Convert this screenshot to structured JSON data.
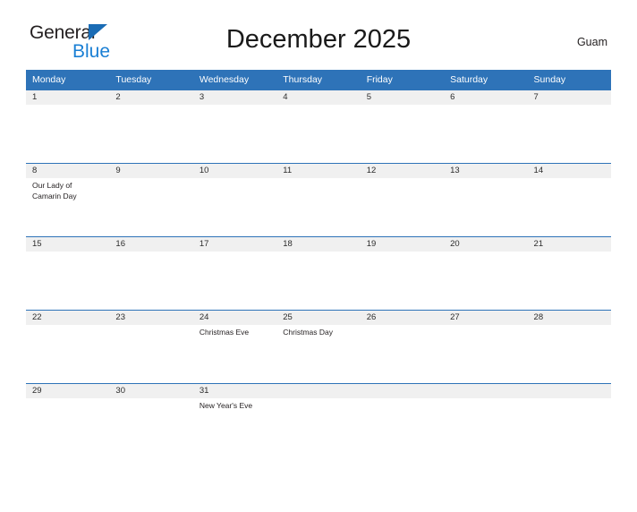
{
  "brand": {
    "name_part1": "General",
    "name_part2": "Blue",
    "flag_icon": "blue-flag-triangle-icon",
    "accent_color": "#1a7fd4"
  },
  "header": {
    "title": "December 2025",
    "region": "Guam"
  },
  "theme": {
    "header_blue": "#2e73b8",
    "band_gray": "#f0f0f0",
    "rule_blue": "#2e73b8",
    "text_dark": "#231f20"
  },
  "calendar": {
    "month": "December",
    "year": "2025",
    "weekday_headers": [
      "Monday",
      "Tuesday",
      "Wednesday",
      "Thursday",
      "Friday",
      "Saturday",
      "Sunday"
    ],
    "weeks": [
      {
        "days": [
          {
            "date": "1",
            "events": []
          },
          {
            "date": "2",
            "events": []
          },
          {
            "date": "3",
            "events": []
          },
          {
            "date": "4",
            "events": []
          },
          {
            "date": "5",
            "events": []
          },
          {
            "date": "6",
            "events": []
          },
          {
            "date": "7",
            "events": []
          }
        ]
      },
      {
        "days": [
          {
            "date": "8",
            "events": [
              "Our Lady of Camarin Day"
            ]
          },
          {
            "date": "9",
            "events": []
          },
          {
            "date": "10",
            "events": []
          },
          {
            "date": "11",
            "events": []
          },
          {
            "date": "12",
            "events": []
          },
          {
            "date": "13",
            "events": []
          },
          {
            "date": "14",
            "events": []
          }
        ]
      },
      {
        "days": [
          {
            "date": "15",
            "events": []
          },
          {
            "date": "16",
            "events": []
          },
          {
            "date": "17",
            "events": []
          },
          {
            "date": "18",
            "events": []
          },
          {
            "date": "19",
            "events": []
          },
          {
            "date": "20",
            "events": []
          },
          {
            "date": "21",
            "events": []
          }
        ]
      },
      {
        "days": [
          {
            "date": "22",
            "events": []
          },
          {
            "date": "23",
            "events": []
          },
          {
            "date": "24",
            "events": [
              "Christmas Eve"
            ]
          },
          {
            "date": "25",
            "events": [
              "Christmas Day"
            ]
          },
          {
            "date": "26",
            "events": []
          },
          {
            "date": "27",
            "events": []
          },
          {
            "date": "28",
            "events": []
          }
        ]
      },
      {
        "days": [
          {
            "date": "29",
            "events": []
          },
          {
            "date": "30",
            "events": []
          },
          {
            "date": "31",
            "events": [
              "New Year's Eve"
            ]
          },
          {
            "date": "",
            "events": []
          },
          {
            "date": "",
            "events": []
          },
          {
            "date": "",
            "events": []
          },
          {
            "date": "",
            "events": []
          }
        ]
      }
    ]
  }
}
